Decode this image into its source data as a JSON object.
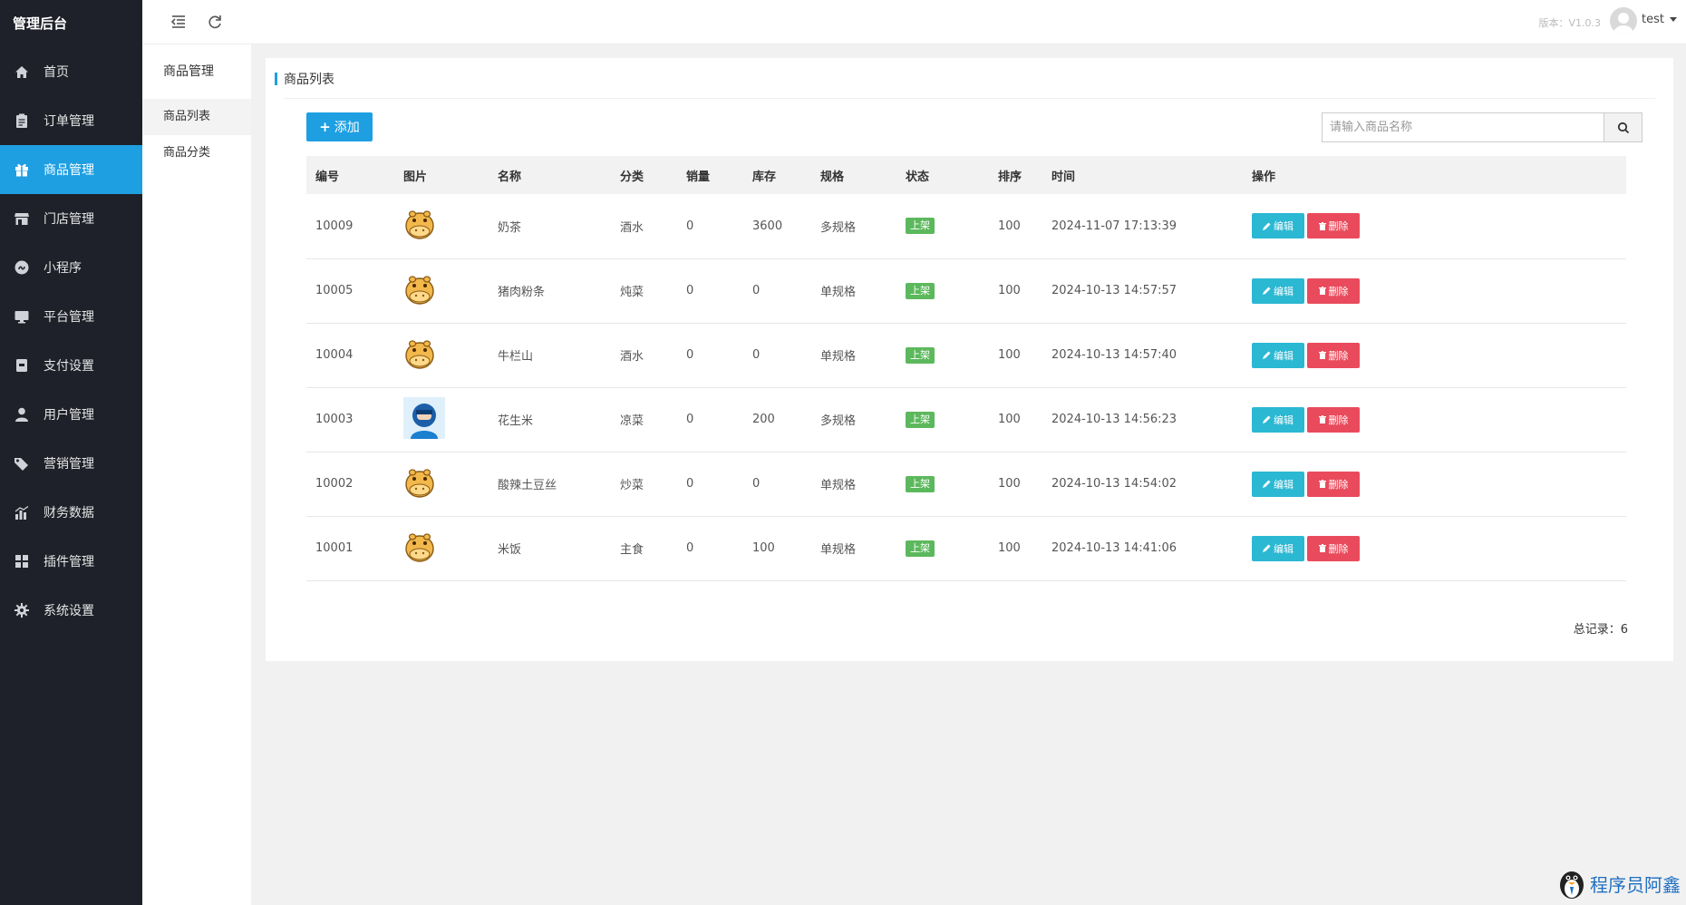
{
  "app": {
    "title": "管理后台"
  },
  "sidebar": {
    "items": [
      {
        "label": "首页",
        "icon": "home-icon"
      },
      {
        "label": "订单管理",
        "icon": "clipboard-icon"
      },
      {
        "label": "商品管理",
        "icon": "gift-icon",
        "active": true
      },
      {
        "label": "门店管理",
        "icon": "store-icon"
      },
      {
        "label": "小程序",
        "icon": "miniprogram-icon"
      },
      {
        "label": "平台管理",
        "icon": "monitor-icon"
      },
      {
        "label": "支付设置",
        "icon": "wallet-icon"
      },
      {
        "label": "用户管理",
        "icon": "user-icon"
      },
      {
        "label": "营销管理",
        "icon": "tag-icon"
      },
      {
        "label": "财务数据",
        "icon": "bar-chart-icon"
      },
      {
        "label": "插件管理",
        "icon": "puzzle-icon"
      },
      {
        "label": "系统设置",
        "icon": "gear-icon"
      }
    ]
  },
  "submenu": {
    "title": "商品管理",
    "items": [
      {
        "label": "商品列表",
        "active": true
      },
      {
        "label": "商品分类"
      }
    ]
  },
  "topbar": {
    "version": "版本：V1.0.3",
    "user": "test"
  },
  "panel": {
    "title": "商品列表",
    "add_label": "添加",
    "search_placeholder": "请输入商品名称",
    "total": "总记录：6"
  },
  "table": {
    "headers": [
      "编号",
      "图片",
      "名称",
      "分类",
      "销量",
      "库存",
      "规格",
      "状态",
      "排序",
      "时间",
      "操作"
    ],
    "edit_label": "编辑",
    "delete_label": "删除",
    "rows": [
      {
        "id": "10009",
        "img": "hippo",
        "name": "奶茶",
        "category": "酒水",
        "sales": "0",
        "stock": "3600",
        "spec": "多规格",
        "spec_color": "red",
        "status": "上架",
        "sort": "100",
        "time": "2024-11-07 17:13:39"
      },
      {
        "id": "10005",
        "img": "hippo",
        "name": "猪肉粉条",
        "category": "炖菜",
        "sales": "0",
        "stock": "0",
        "spec": "单规格",
        "spec_color": "green",
        "status": "上架",
        "sort": "100",
        "time": "2024-10-13 14:57:57"
      },
      {
        "id": "10004",
        "img": "hippo",
        "name": "牛栏山",
        "category": "酒水",
        "sales": "0",
        "stock": "0",
        "spec": "单规格",
        "spec_color": "green",
        "status": "上架",
        "sort": "100",
        "time": "2024-10-13 14:57:40"
      },
      {
        "id": "10003",
        "img": "avatar",
        "name": "花生米",
        "category": "凉菜",
        "sales": "0",
        "stock": "200",
        "spec": "多规格",
        "spec_color": "red",
        "status": "上架",
        "sort": "100",
        "time": "2024-10-13 14:56:23"
      },
      {
        "id": "10002",
        "img": "hippo",
        "name": "酸辣土豆丝",
        "category": "炒菜",
        "sales": "0",
        "stock": "0",
        "spec": "单规格",
        "spec_color": "green",
        "status": "上架",
        "sort": "100",
        "time": "2024-10-13 14:54:02"
      },
      {
        "id": "10001",
        "img": "hippo",
        "name": "米饭",
        "category": "主食",
        "sales": "0",
        "stock": "100",
        "spec": "单规格",
        "spec_color": "green",
        "status": "上架",
        "sort": "100",
        "time": "2024-10-13 14:41:06"
      }
    ]
  },
  "watermark": {
    "text": "程序员阿鑫"
  },
  "colors": {
    "sidebar_bg": "#1e2129",
    "accent": "#1e9fe2",
    "edit": "#2bb8d3",
    "delete": "#e94b5c",
    "on_shelf": "#5cb85c",
    "multi_spec": "#e4393c"
  }
}
